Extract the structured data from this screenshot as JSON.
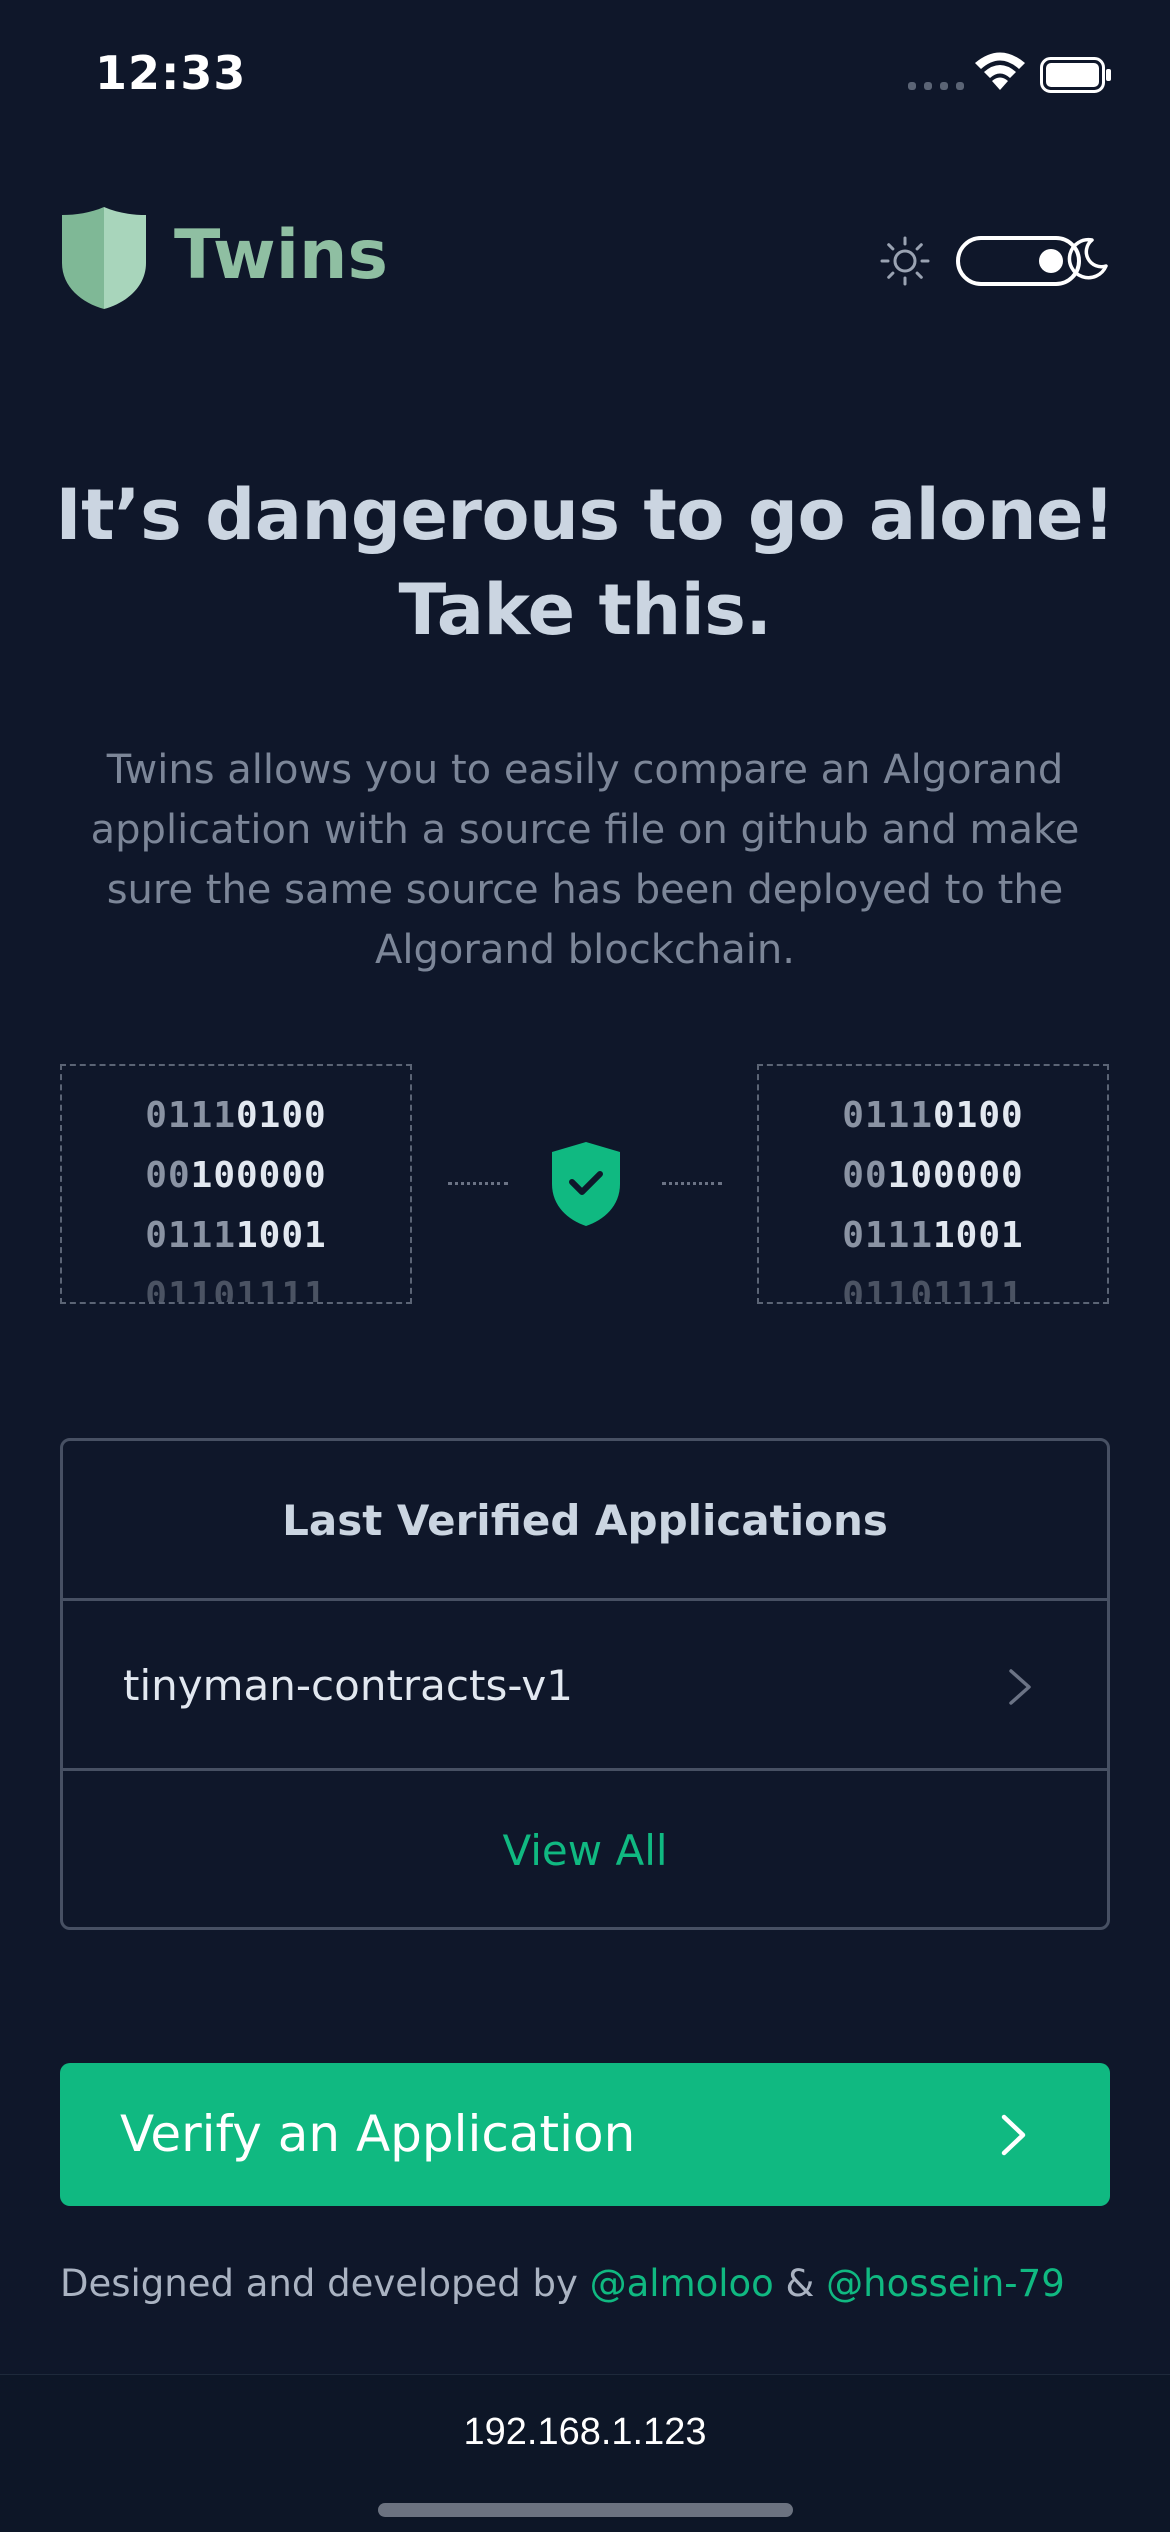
{
  "status_bar": {
    "time": "12:33"
  },
  "header": {
    "brand": "Twins"
  },
  "hero": {
    "title_line1": "It’s dangerous to go alone!",
    "title_line2": "Take this.",
    "description": "Twins allows you to easily compare an Algorand application with a source file on github and make sure the same source has been deployed to the Algorand blockchain."
  },
  "binary": {
    "lines": [
      {
        "a": "0111",
        "b": "0100"
      },
      {
        "a": "00",
        "b": "100000",
        "lead": true
      },
      {
        "a": "0111",
        "b": "1001"
      },
      {
        "a": "01101111",
        "b": ""
      }
    ]
  },
  "last_verified": {
    "title": "Last Verified Applications",
    "items": [
      {
        "label": "tinyman-contracts-v1"
      }
    ],
    "view_all": "View All"
  },
  "cta": {
    "label": "Verify an Application"
  },
  "credits": {
    "prefix": "Designed and developed by ",
    "author1": "@almoloo",
    "separator": " & ",
    "author2": "@hossein-79"
  },
  "browser": {
    "address": "192.168.1.123"
  },
  "colors": {
    "accent": "#10b981",
    "background": "#0f172a",
    "logo": "#8fbfa2"
  },
  "icons": [
    "shield-logo-icon",
    "sun-icon",
    "moon-icon",
    "shield-check-icon",
    "chevron-right-icon",
    "wifi-icon",
    "battery-icon"
  ]
}
